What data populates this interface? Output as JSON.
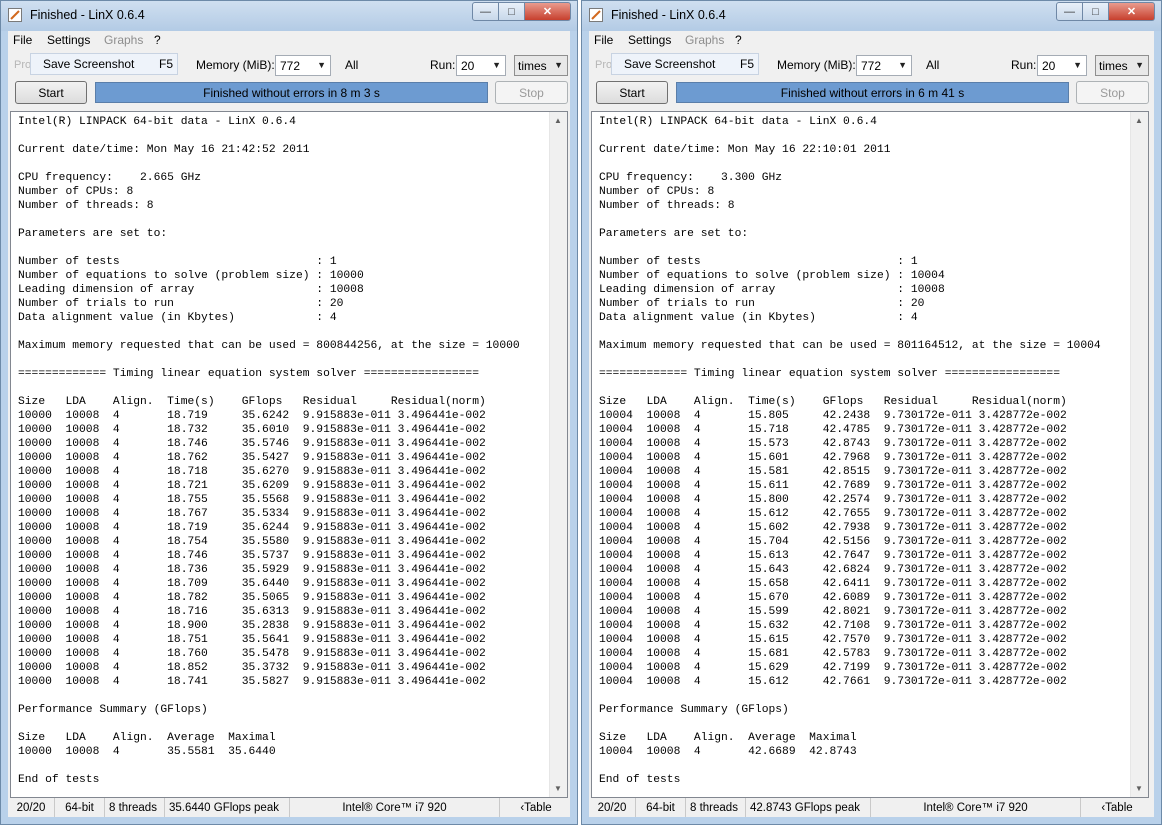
{
  "colors": {
    "window_frame": "#b9d1ea",
    "status_fill": "#6d9bd1",
    "close_button": "#c7402e"
  },
  "windows": [
    {
      "title": "Finished - LinX 0.6.4",
      "menu": {
        "file": "File",
        "settings": "Settings",
        "graphs": "Graphs",
        "help": "?"
      },
      "toolbar": {
        "problem_ghost": "Proble",
        "screenshot_label": "Save Screenshot",
        "screenshot_shortcut": "F5",
        "memory_label": "Memory (MiB):",
        "memory_value": "772",
        "all_label": "All",
        "run_label": "Run:",
        "run_value": "20",
        "run_unit": "times"
      },
      "controls": {
        "start": "Start",
        "status": "Finished without errors in 8 m 3 s",
        "stop": "Stop"
      },
      "output_lines": [
        "Intel(R) LINPACK 64-bit data - LinX 0.6.4",
        "",
        "Current date/time: Mon May 16 21:42:52 2011",
        "",
        "CPU frequency:    2.665 GHz",
        "Number of CPUs: 8",
        "Number of threads: 8",
        "",
        "Parameters are set to:",
        "",
        "Number of tests                             : 1",
        "Number of equations to solve (problem size) : 10000",
        "Leading dimension of array                  : 10008",
        "Number of trials to run                     : 20",
        "Data alignment value (in Kbytes)            : 4",
        "",
        "Maximum memory requested that can be used = 800844256, at the size = 10000",
        "",
        "============= Timing linear equation system solver =================",
        "",
        "Size   LDA    Align.  Time(s)    GFlops   Residual     Residual(norm)",
        "10000  10008  4       18.719     35.6242  9.915883e-011 3.496441e-002",
        "10000  10008  4       18.732     35.6010  9.915883e-011 3.496441e-002",
        "10000  10008  4       18.746     35.5746  9.915883e-011 3.496441e-002",
        "10000  10008  4       18.762     35.5427  9.915883e-011 3.496441e-002",
        "10000  10008  4       18.718     35.6270  9.915883e-011 3.496441e-002",
        "10000  10008  4       18.721     35.6209  9.915883e-011 3.496441e-002",
        "10000  10008  4       18.755     35.5568  9.915883e-011 3.496441e-002",
        "10000  10008  4       18.767     35.5334  9.915883e-011 3.496441e-002",
        "10000  10008  4       18.719     35.6244  9.915883e-011 3.496441e-002",
        "10000  10008  4       18.754     35.5580  9.915883e-011 3.496441e-002",
        "10000  10008  4       18.746     35.5737  9.915883e-011 3.496441e-002",
        "10000  10008  4       18.736     35.5929  9.915883e-011 3.496441e-002",
        "10000  10008  4       18.709     35.6440  9.915883e-011 3.496441e-002",
        "10000  10008  4       18.782     35.5065  9.915883e-011 3.496441e-002",
        "10000  10008  4       18.716     35.6313  9.915883e-011 3.496441e-002",
        "10000  10008  4       18.900     35.2838  9.915883e-011 3.496441e-002",
        "10000  10008  4       18.751     35.5641  9.915883e-011 3.496441e-002",
        "10000  10008  4       18.760     35.5478  9.915883e-011 3.496441e-002",
        "10000  10008  4       18.852     35.3732  9.915883e-011 3.496441e-002",
        "10000  10008  4       18.741     35.5827  9.915883e-011 3.496441e-002",
        "",
        "Performance Summary (GFlops)",
        "",
        "Size   LDA    Align.  Average  Maximal",
        "10000  10008  4       35.5581  35.6440",
        "",
        "End of tests"
      ],
      "statusbar": {
        "progress": "20/20",
        "bits": "64-bit",
        "threads": "8 threads",
        "peak": "35.6440 GFlops peak",
        "cpu": "Intel® Core™ i7 920",
        "table": "‹Table"
      }
    },
    {
      "title": "Finished - LinX 0.6.4",
      "menu": {
        "file": "File",
        "settings": "Settings",
        "graphs": "Graphs",
        "help": "?"
      },
      "toolbar": {
        "problem_ghost": "Proble",
        "screenshot_label": "Save Screenshot",
        "screenshot_shortcut": "F5",
        "memory_label": "Memory (MiB):",
        "memory_value": "772",
        "all_label": "All",
        "run_label": "Run:",
        "run_value": "20",
        "run_unit": "times"
      },
      "controls": {
        "start": "Start",
        "status": "Finished without errors in 6 m 41 s",
        "stop": "Stop"
      },
      "output_lines": [
        "Intel(R) LINPACK 64-bit data - LinX 0.6.4",
        "",
        "Current date/time: Mon May 16 22:10:01 2011",
        "",
        "CPU frequency:    3.300 GHz",
        "Number of CPUs: 8",
        "Number of threads: 8",
        "",
        "Parameters are set to:",
        "",
        "Number of tests                             : 1",
        "Number of equations to solve (problem size) : 10004",
        "Leading dimension of array                  : 10008",
        "Number of trials to run                     : 20",
        "Data alignment value (in Kbytes)            : 4",
        "",
        "Maximum memory requested that can be used = 801164512, at the size = 10004",
        "",
        "============= Timing linear equation system solver =================",
        "",
        "Size   LDA    Align.  Time(s)    GFlops   Residual     Residual(norm)",
        "10004  10008  4       15.805     42.2438  9.730172e-011 3.428772e-002",
        "10004  10008  4       15.718     42.4785  9.730172e-011 3.428772e-002",
        "10004  10008  4       15.573     42.8743  9.730172e-011 3.428772e-002",
        "10004  10008  4       15.601     42.7968  9.730172e-011 3.428772e-002",
        "10004  10008  4       15.581     42.8515  9.730172e-011 3.428772e-002",
        "10004  10008  4       15.611     42.7689  9.730172e-011 3.428772e-002",
        "10004  10008  4       15.800     42.2574  9.730172e-011 3.428772e-002",
        "10004  10008  4       15.612     42.7655  9.730172e-011 3.428772e-002",
        "10004  10008  4       15.602     42.7938  9.730172e-011 3.428772e-002",
        "10004  10008  4       15.704     42.5156  9.730172e-011 3.428772e-002",
        "10004  10008  4       15.613     42.7647  9.730172e-011 3.428772e-002",
        "10004  10008  4       15.643     42.6824  9.730172e-011 3.428772e-002",
        "10004  10008  4       15.658     42.6411  9.730172e-011 3.428772e-002",
        "10004  10008  4       15.670     42.6089  9.730172e-011 3.428772e-002",
        "10004  10008  4       15.599     42.8021  9.730172e-011 3.428772e-002",
        "10004  10008  4       15.632     42.7108  9.730172e-011 3.428772e-002",
        "10004  10008  4       15.615     42.7570  9.730172e-011 3.428772e-002",
        "10004  10008  4       15.681     42.5783  9.730172e-011 3.428772e-002",
        "10004  10008  4       15.629     42.7199  9.730172e-011 3.428772e-002",
        "10004  10008  4       15.612     42.7661  9.730172e-011 3.428772e-002",
        "",
        "Performance Summary (GFlops)",
        "",
        "Size   LDA    Align.  Average  Maximal",
        "10004  10008  4       42.6689  42.8743",
        "",
        "End of tests"
      ],
      "statusbar": {
        "progress": "20/20",
        "bits": "64-bit",
        "threads": "8 threads",
        "peak": "42.8743 GFlops peak",
        "cpu": "Intel® Core™ i7 920",
        "table": "‹Table"
      }
    }
  ]
}
